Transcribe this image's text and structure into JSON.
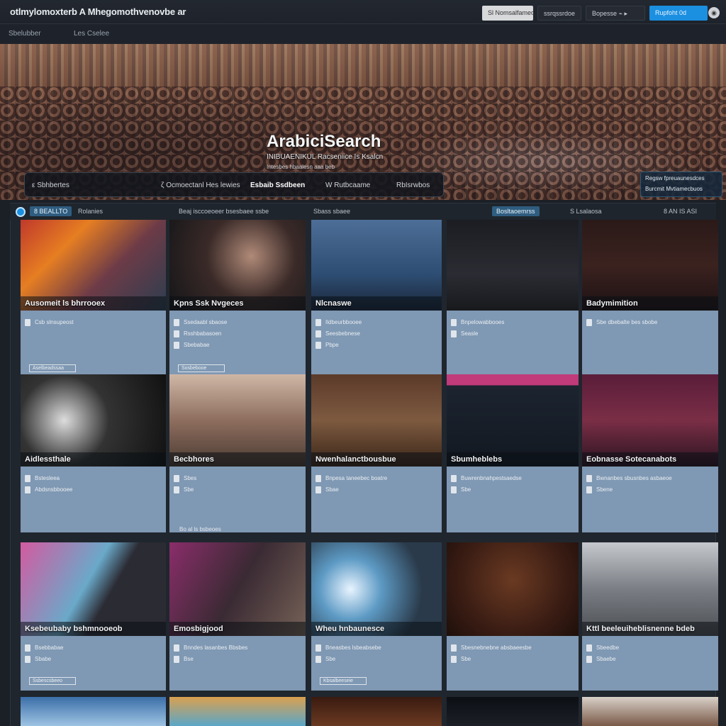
{
  "topbar": {
    "brand": "otlmylomoxterb A Mhegomothvenovbe ar",
    "buttons": [
      "Sl Nomsalfamed",
      "ssrqssrdoe",
      "Bopesse  ⌁ ▸",
      "Rupfoht  0d"
    ],
    "user_icon": "user-icon"
  },
  "subbar": {
    "left": "Sbelubber",
    "mid": "Les Cselee"
  },
  "hero": {
    "title": "ArabiciSearch",
    "subtitle": "INIBUAENIKUL Racseniice Is Ksalcn",
    "subtitle2": "Intesbes hbaalesn aaa beb",
    "nav": [
      "ε Sbhbertes",
      "ζ Ocmoectanl Hes lewies",
      "Esbaib Ssdbeen",
      "W Rutbcaame",
      "RbIsrwbos"
    ],
    "badge_line1": "Regsw fpreuaunesdces",
    "badge_line2": "Burcmit Mvtiamecbuos"
  },
  "filterbar": {
    "chip": "8 BEALLTO",
    "items": [
      "Rolanies",
      "Beaj isccoeoeer bsesbaee ssbe",
      "Sbass sbaee",
      "Bosltaoemrss",
      "S  Lsalaosa",
      "8 AN IS   ASI"
    ]
  },
  "cards": [
    {
      "caption": "Ausomeit ls bhrrooex",
      "meta": [
        "Csb slnsupeost"
      ],
      "button": "Aselbeadssaa"
    },
    {
      "caption": "Kpns Ssk Nvgeces",
      "meta": [
        "Ssedaabl sbaose",
        "Rsshbabasoen",
        "Sbebabae"
      ],
      "button": "Sosbebooe"
    },
    {
      "caption": "Nlcnaswe",
      "meta": [
        "Ildbeurbbooee",
        "Seesbebnese",
        "Pbpe"
      ],
      "button": ""
    },
    {
      "caption": "",
      "meta": [
        "Bnpelowabbooes",
        "Seasle"
      ],
      "button": ""
    },
    {
      "caption": "Badymimition",
      "meta": [
        "Sbe dbebalte bes sbobe"
      ],
      "button": ""
    },
    {
      "caption": "Aidlessthale",
      "meta": [
        "Bstesleea",
        "Abdsnsbbooee"
      ],
      "button": ""
    },
    {
      "caption": "Becbhores",
      "meta": [
        "Sbes",
        "Sbe"
      ],
      "button": ""
    },
    {
      "caption": "Nwenhalanctbousbue",
      "meta": [
        "Bnpesa taneebec boatre",
        "Sbae"
      ],
      "button": ""
    },
    {
      "caption": "Sbumheblebs",
      "meta": [
        "Buwrenbnahpestsaedse",
        "Sbe"
      ],
      "button": ""
    },
    {
      "caption": "Eobnasse Sotecanabots",
      "meta": [
        "Bwnanbes sbusnbes asbaeoe",
        "Sbene"
      ],
      "button": ""
    },
    {
      "caption": "Ksebeubaby bshmnooeob",
      "meta": [
        "Bsebbabae",
        "Sbabe"
      ],
      "button": "Ssbescsbeeo"
    },
    {
      "caption": "Emosbigjood",
      "meta": [
        "Bnndes lasanbes Bbsbes",
        "Bse"
      ],
      "button": ""
    },
    {
      "caption": "Wheu hnbaunesce",
      "meta": [
        "Bneasbes lsbeabsebe",
        "Sbe"
      ],
      "button": "Kbsalbeeseie"
    },
    {
      "caption": "",
      "meta": [
        "Sbesnebnebne absbaeesbe",
        "Sbe"
      ],
      "button": ""
    },
    {
      "caption": "Kttl beeleuiheblisnenne bdeb",
      "meta": [
        "Sbeedbe",
        "Sbaebe"
      ],
      "button": ""
    }
  ],
  "misc": {
    "grid_note": "Bo al ls bsbeoes"
  }
}
